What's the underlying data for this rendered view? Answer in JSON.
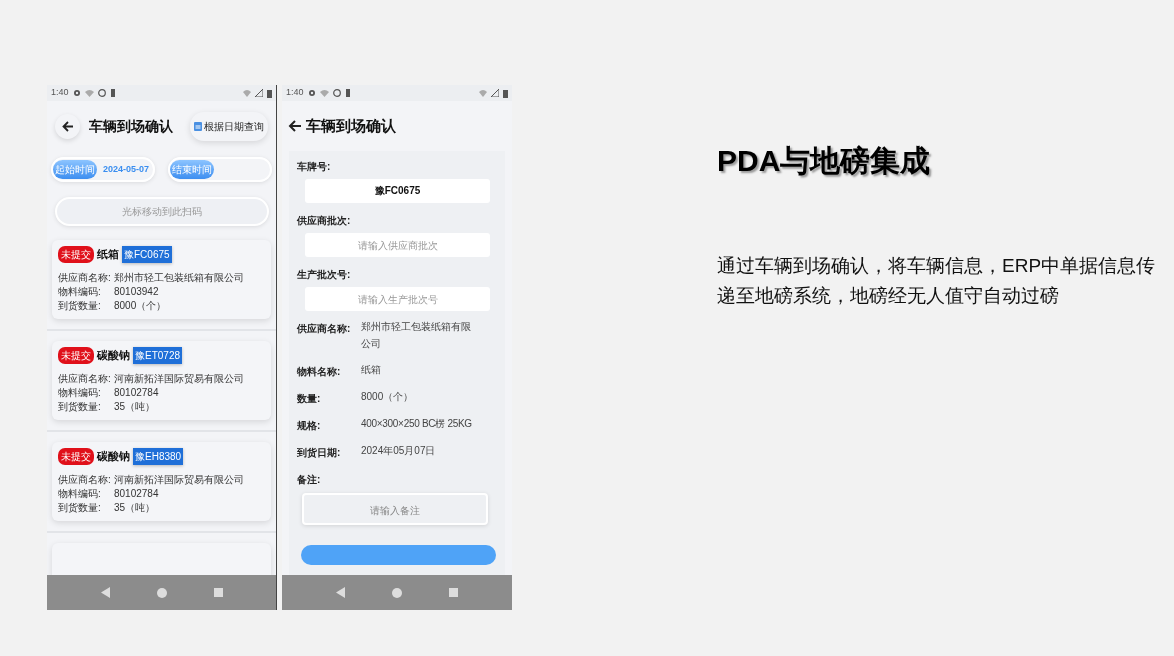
{
  "list_screen": {
    "status_bar": {
      "time": "1:40"
    },
    "title": "车辆到场确认",
    "query_button": "根据日期查询",
    "date_filters": [
      {
        "chip": "起始时间",
        "value": "2024-05-07"
      },
      {
        "chip": "结束时间"
      }
    ],
    "scan_field": {
      "placeholder": "光标移动到此扫码"
    },
    "cards": [
      {
        "status": "未提交",
        "name": "纸箱",
        "plate": "豫FC0675",
        "fields": [
          {
            "label": "供应商名称:",
            "value": "郑州市轻工包装纸箱有限公司"
          },
          {
            "label": "物料编码:",
            "value": "80103942"
          },
          {
            "label": "到货数量:",
            "value": "8000（个）"
          }
        ]
      },
      {
        "status": "未提交",
        "name": "碳酸钠",
        "plate": "豫ET0728",
        "fields": [
          {
            "label": "供应商名称:",
            "value": "河南新拓洋国际贸易有限公司"
          },
          {
            "label": "物料编码:",
            "value": "80102784"
          },
          {
            "label": "到货数量:",
            "value": "35（吨）"
          }
        ]
      },
      {
        "status": "未提交",
        "name": "碳酸钠",
        "plate": "豫EH8380",
        "fields": [
          {
            "label": "供应商名称:",
            "value": "河南新拓洋国际贸易有限公司"
          },
          {
            "label": "物料编码:",
            "value": "80102784"
          },
          {
            "label": "到货数量:",
            "value": "35（吨）"
          }
        ]
      }
    ]
  },
  "detail_screen": {
    "status_bar": {
      "time": "1:40"
    },
    "title": "车辆到场确认",
    "form": [
      {
        "kind": "input",
        "label": "车牌号:",
        "value": "豫FC0675"
      },
      {
        "kind": "input",
        "label": "供应商批次:",
        "placeholder": "请输入供应商批次"
      },
      {
        "kind": "input",
        "label": "生产批次号:",
        "placeholder": "请输入生产批次号"
      },
      {
        "kind": "info",
        "label": "供应商名称:",
        "value": "郑州市轻工包装纸箱有限公司"
      },
      {
        "kind": "info",
        "label": "物料名称:",
        "value": "纸箱"
      },
      {
        "kind": "info",
        "label": "数量:",
        "value": "8000（个）"
      },
      {
        "kind": "small_info",
        "label": "规格:",
        "value": "400×300×250 BC楞 25KG"
      },
      {
        "kind": "info",
        "label": "到货日期:",
        "value": "2024年05月07日"
      },
      {
        "kind": "textarea",
        "label": "备注:",
        "placeholder": "请输入备注"
      }
    ]
  },
  "slide": {
    "title": "PDA与地磅集成",
    "body": "通过车辆到场确认，将车辆信息，ERP中单据信息传递至地磅系统，地磅经无人值守自动过磅"
  }
}
